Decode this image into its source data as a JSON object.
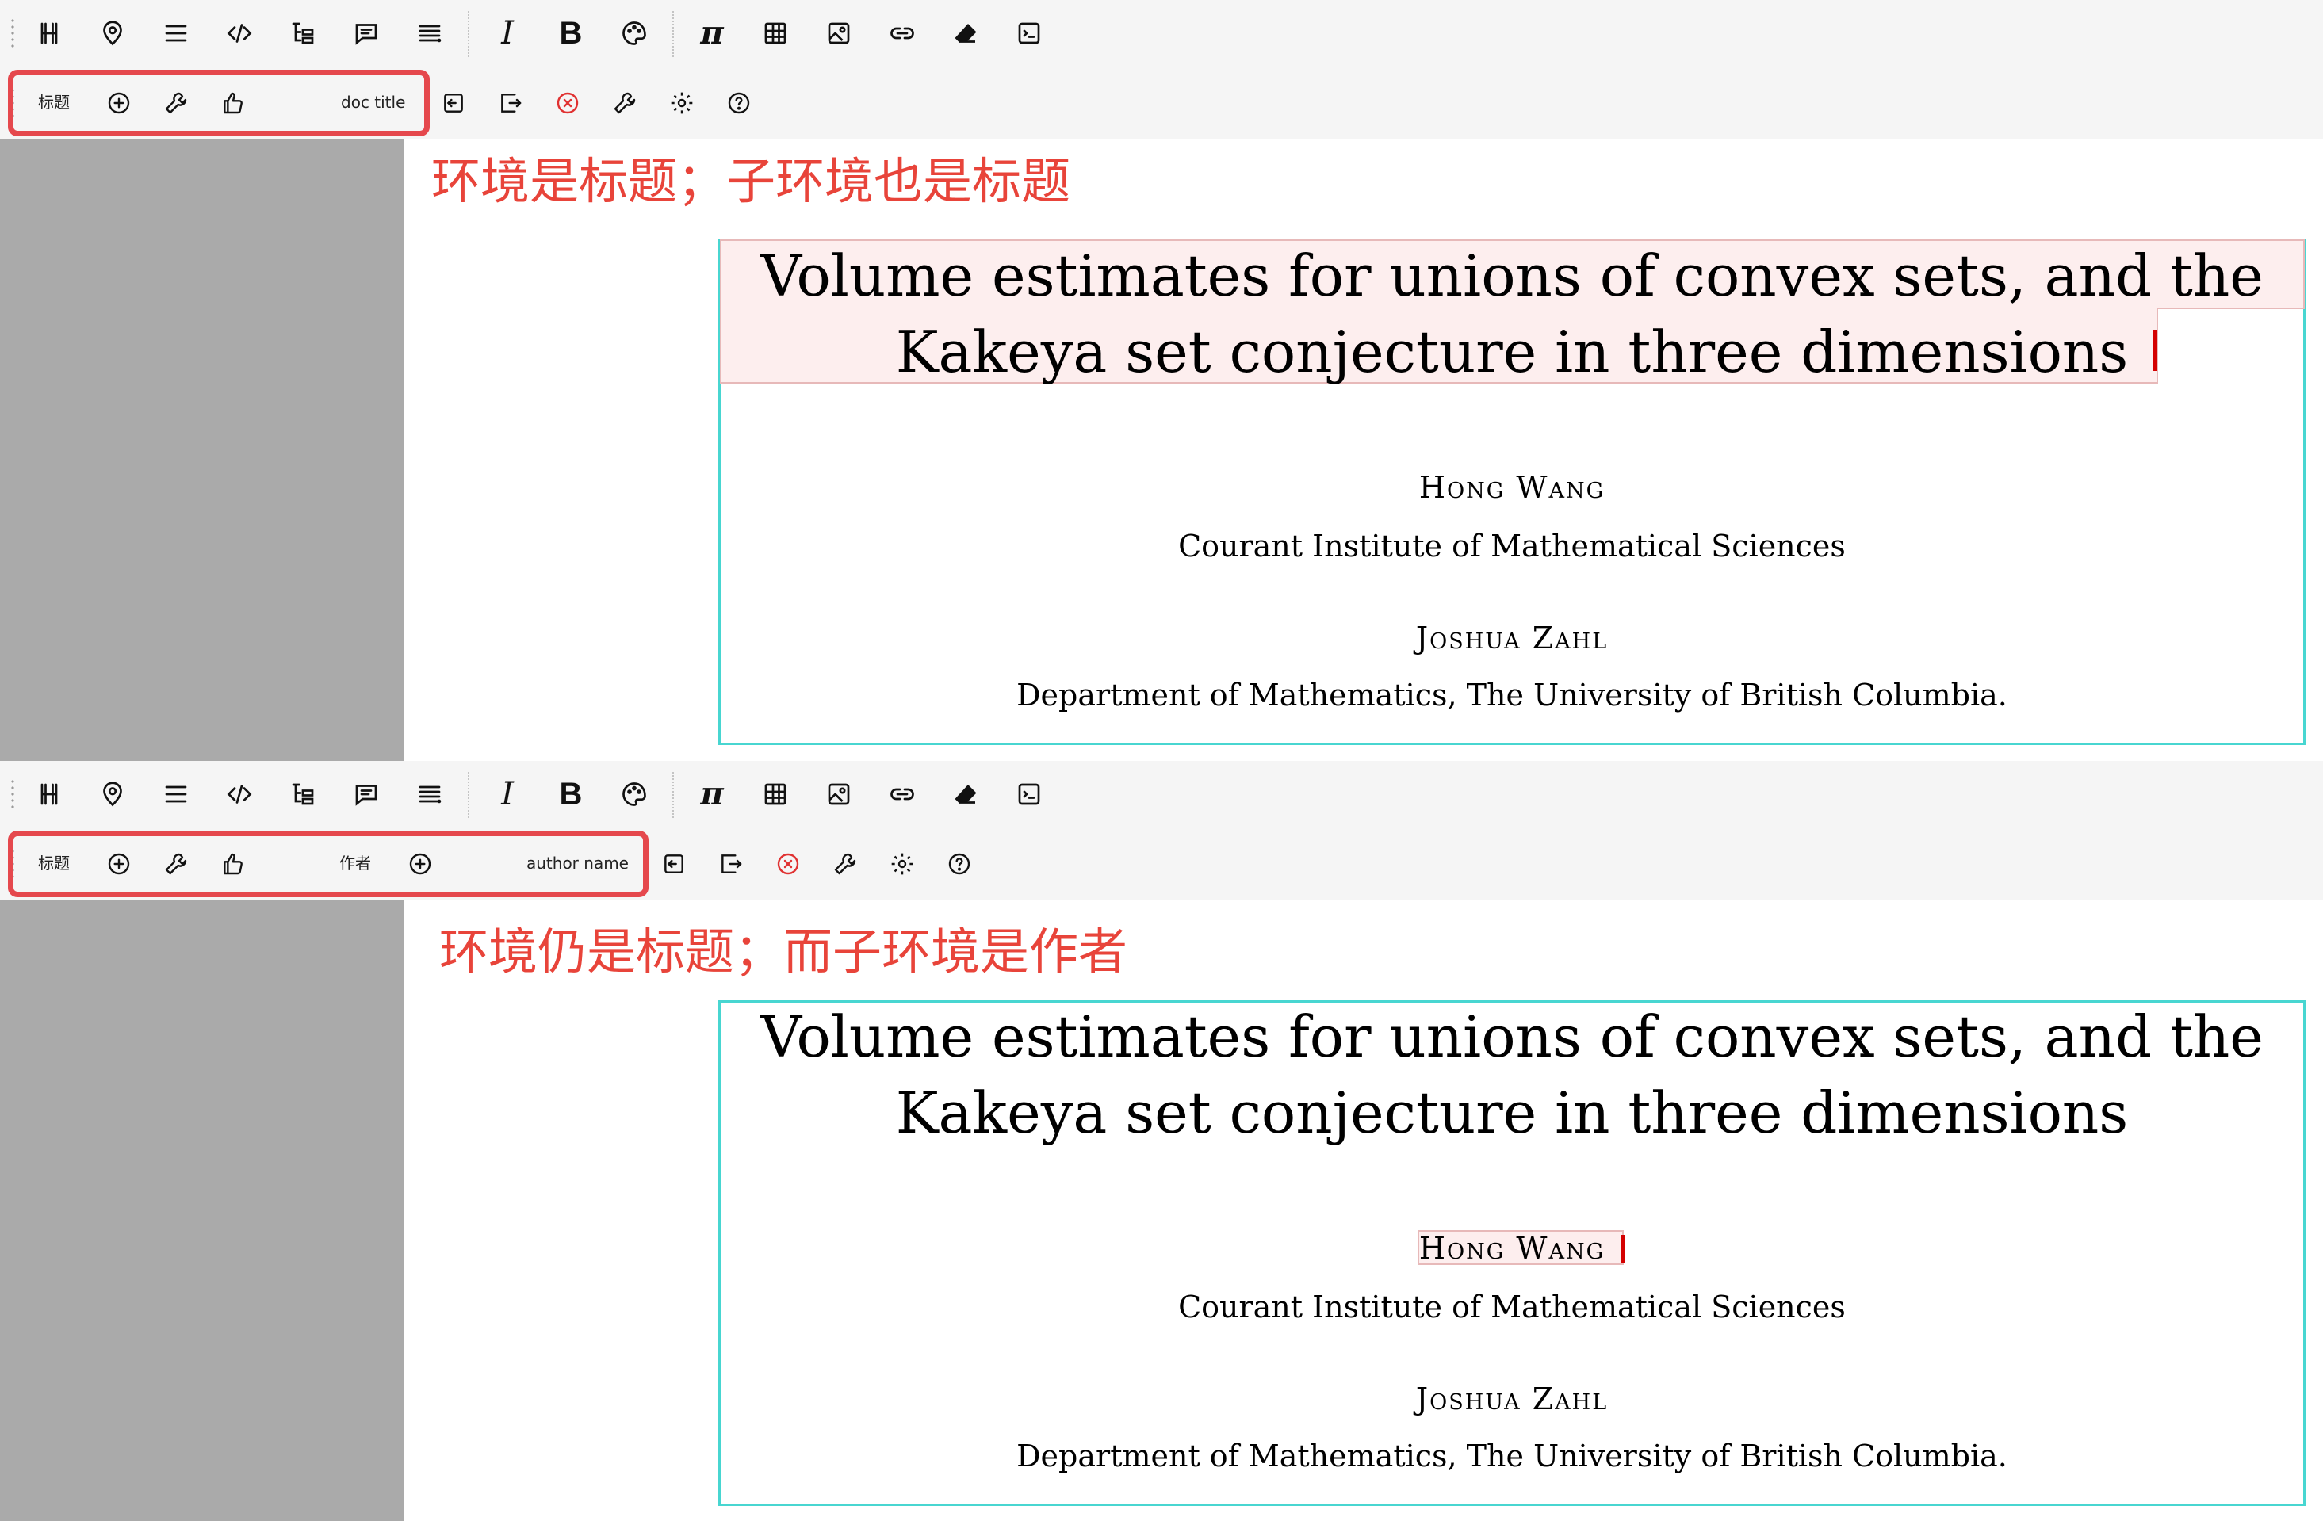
{
  "colors": {
    "annotation": "#e8443a",
    "highlight_border": "#e5484d",
    "doc_frame": "#48d6d1",
    "selection_fill": "#fdeeee",
    "cursor": "#d40000",
    "delete_icon": "#e03131"
  },
  "toolbar_icons": [
    "heading-icon",
    "pin-icon",
    "list-icon",
    "code-icon",
    "tree-icon",
    "comment-icon",
    "align-icon",
    "italic-icon",
    "bold-icon",
    "palette-icon",
    "pi-icon",
    "table-icon",
    "image-icon",
    "link-icon",
    "eraser-icon",
    "terminal-icon"
  ],
  "toolbar_glyphs": {
    "italic": "I",
    "bold": "B",
    "pi": "π"
  },
  "panels": [
    {
      "env_bar": {
        "env_label": "标题",
        "like_icon": "thumbs-up-icon",
        "env_hint": "doc title",
        "action_icons": [
          "enter-icon",
          "exit-icon",
          "delete-icon",
          "wrench-icon",
          "gear-icon",
          "help-icon"
        ]
      },
      "annotation": "环境是标题；子环境也是标题",
      "document": {
        "title_line_1": "Volume estimates for unions of convex sets, and the",
        "title_line_2": "Kakeya set conjecture in three dimensions",
        "author_1": "Hong Wang",
        "affiliation_1": "Courant Institute of Mathematical Sciences",
        "author_2": "Joshua Zahl",
        "affiliation_2": "Department of Mathematics, The University of British Columbia."
      }
    },
    {
      "env_bar": {
        "env_label": "标题",
        "sub_env_label": "作者",
        "env_hint": "author name",
        "action_icons": [
          "enter-icon",
          "exit-icon",
          "delete-icon",
          "wrench-icon",
          "gear-icon",
          "help-icon"
        ]
      },
      "annotation": "环境仍是标题；而子环境是作者",
      "document": {
        "title_line_1": "Volume estimates for unions of convex sets, and the",
        "title_line_2": "Kakeya set conjecture in three dimensions",
        "author_1": "Hong Wang",
        "affiliation_1": "Courant Institute of Mathematical Sciences",
        "author_2": "Joshua Zahl",
        "affiliation_2": "Department of Mathematics, The University of British Columbia."
      }
    }
  ]
}
